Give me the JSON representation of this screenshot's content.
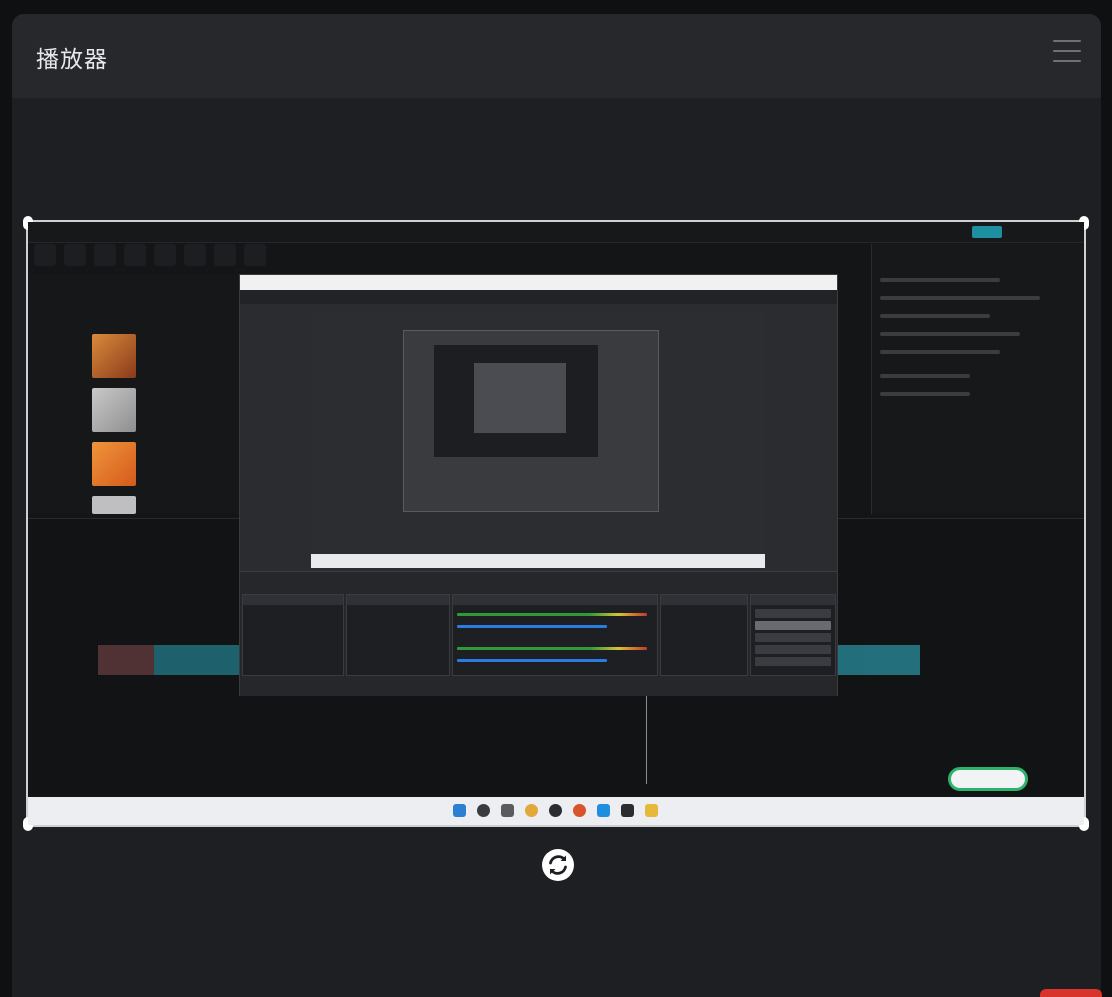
{
  "header": {
    "title": "播放器",
    "menu_icon": "hamburger-menu-icon"
  },
  "player": {
    "content_icon": "video-frame",
    "refresh_icon": "refresh-icon"
  },
  "colors": {
    "background": "#0f1012",
    "panel": "#1e1f22",
    "header": "#27282c",
    "accent_teal": "#1e8fa0",
    "badge_green": "#2cb26a",
    "corner_red": "#d9342b"
  }
}
